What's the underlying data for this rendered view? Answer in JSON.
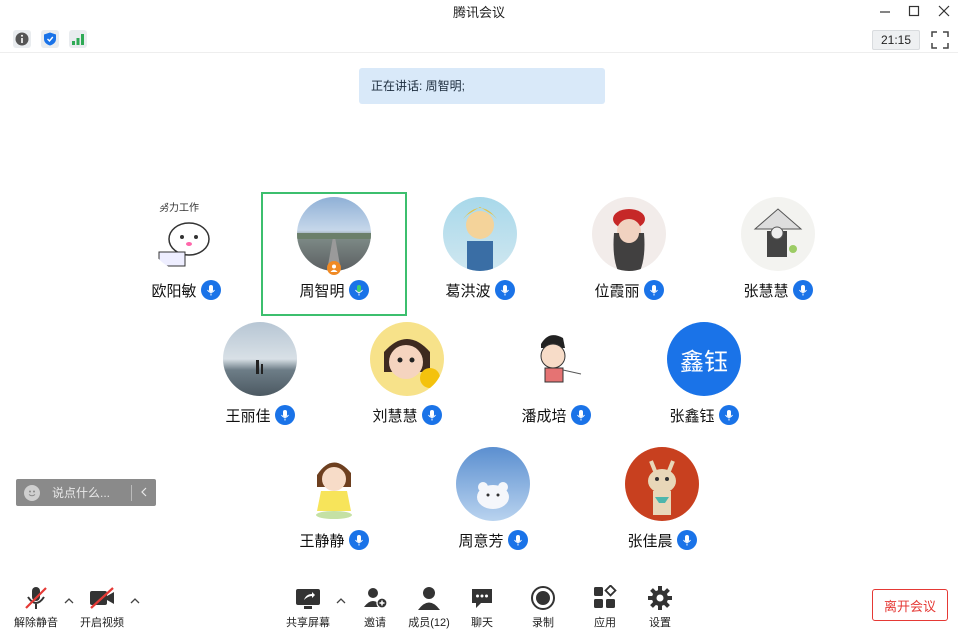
{
  "window": {
    "title": "腾讯会议"
  },
  "toolbar": {
    "clock": "21:15"
  },
  "speaking": {
    "text": "正在讲话: 周智明;"
  },
  "participants": [
    {
      "name": "欧阳敏",
      "avatar_caption": "努力工作"
    },
    {
      "name": "周智明"
    },
    {
      "name": "葛洪波"
    },
    {
      "name": "位霞丽"
    },
    {
      "name": "张慧慧"
    },
    {
      "name": "王丽佳"
    },
    {
      "name": "刘慧慧"
    },
    {
      "name": "潘成培"
    },
    {
      "name": "张鑫钰",
      "avatar_text": "鑫钰"
    },
    {
      "name": "王静静"
    },
    {
      "name": "周意芳"
    },
    {
      "name": "张佳晨"
    }
  ],
  "chat": {
    "placeholder": "说点什么..."
  },
  "bottom": {
    "unmute": "解除静音",
    "video": "开启视频",
    "share": "共享屏幕",
    "invite": "邀请",
    "members": "成员(12)",
    "chat": "聊天",
    "record": "录制",
    "apps": "应用",
    "settings": "设置",
    "leave": "离开会议"
  },
  "colors": {
    "accent": "#1a73e8",
    "active_speaker_border": "#3cbf6e",
    "leave": "#e53935"
  }
}
